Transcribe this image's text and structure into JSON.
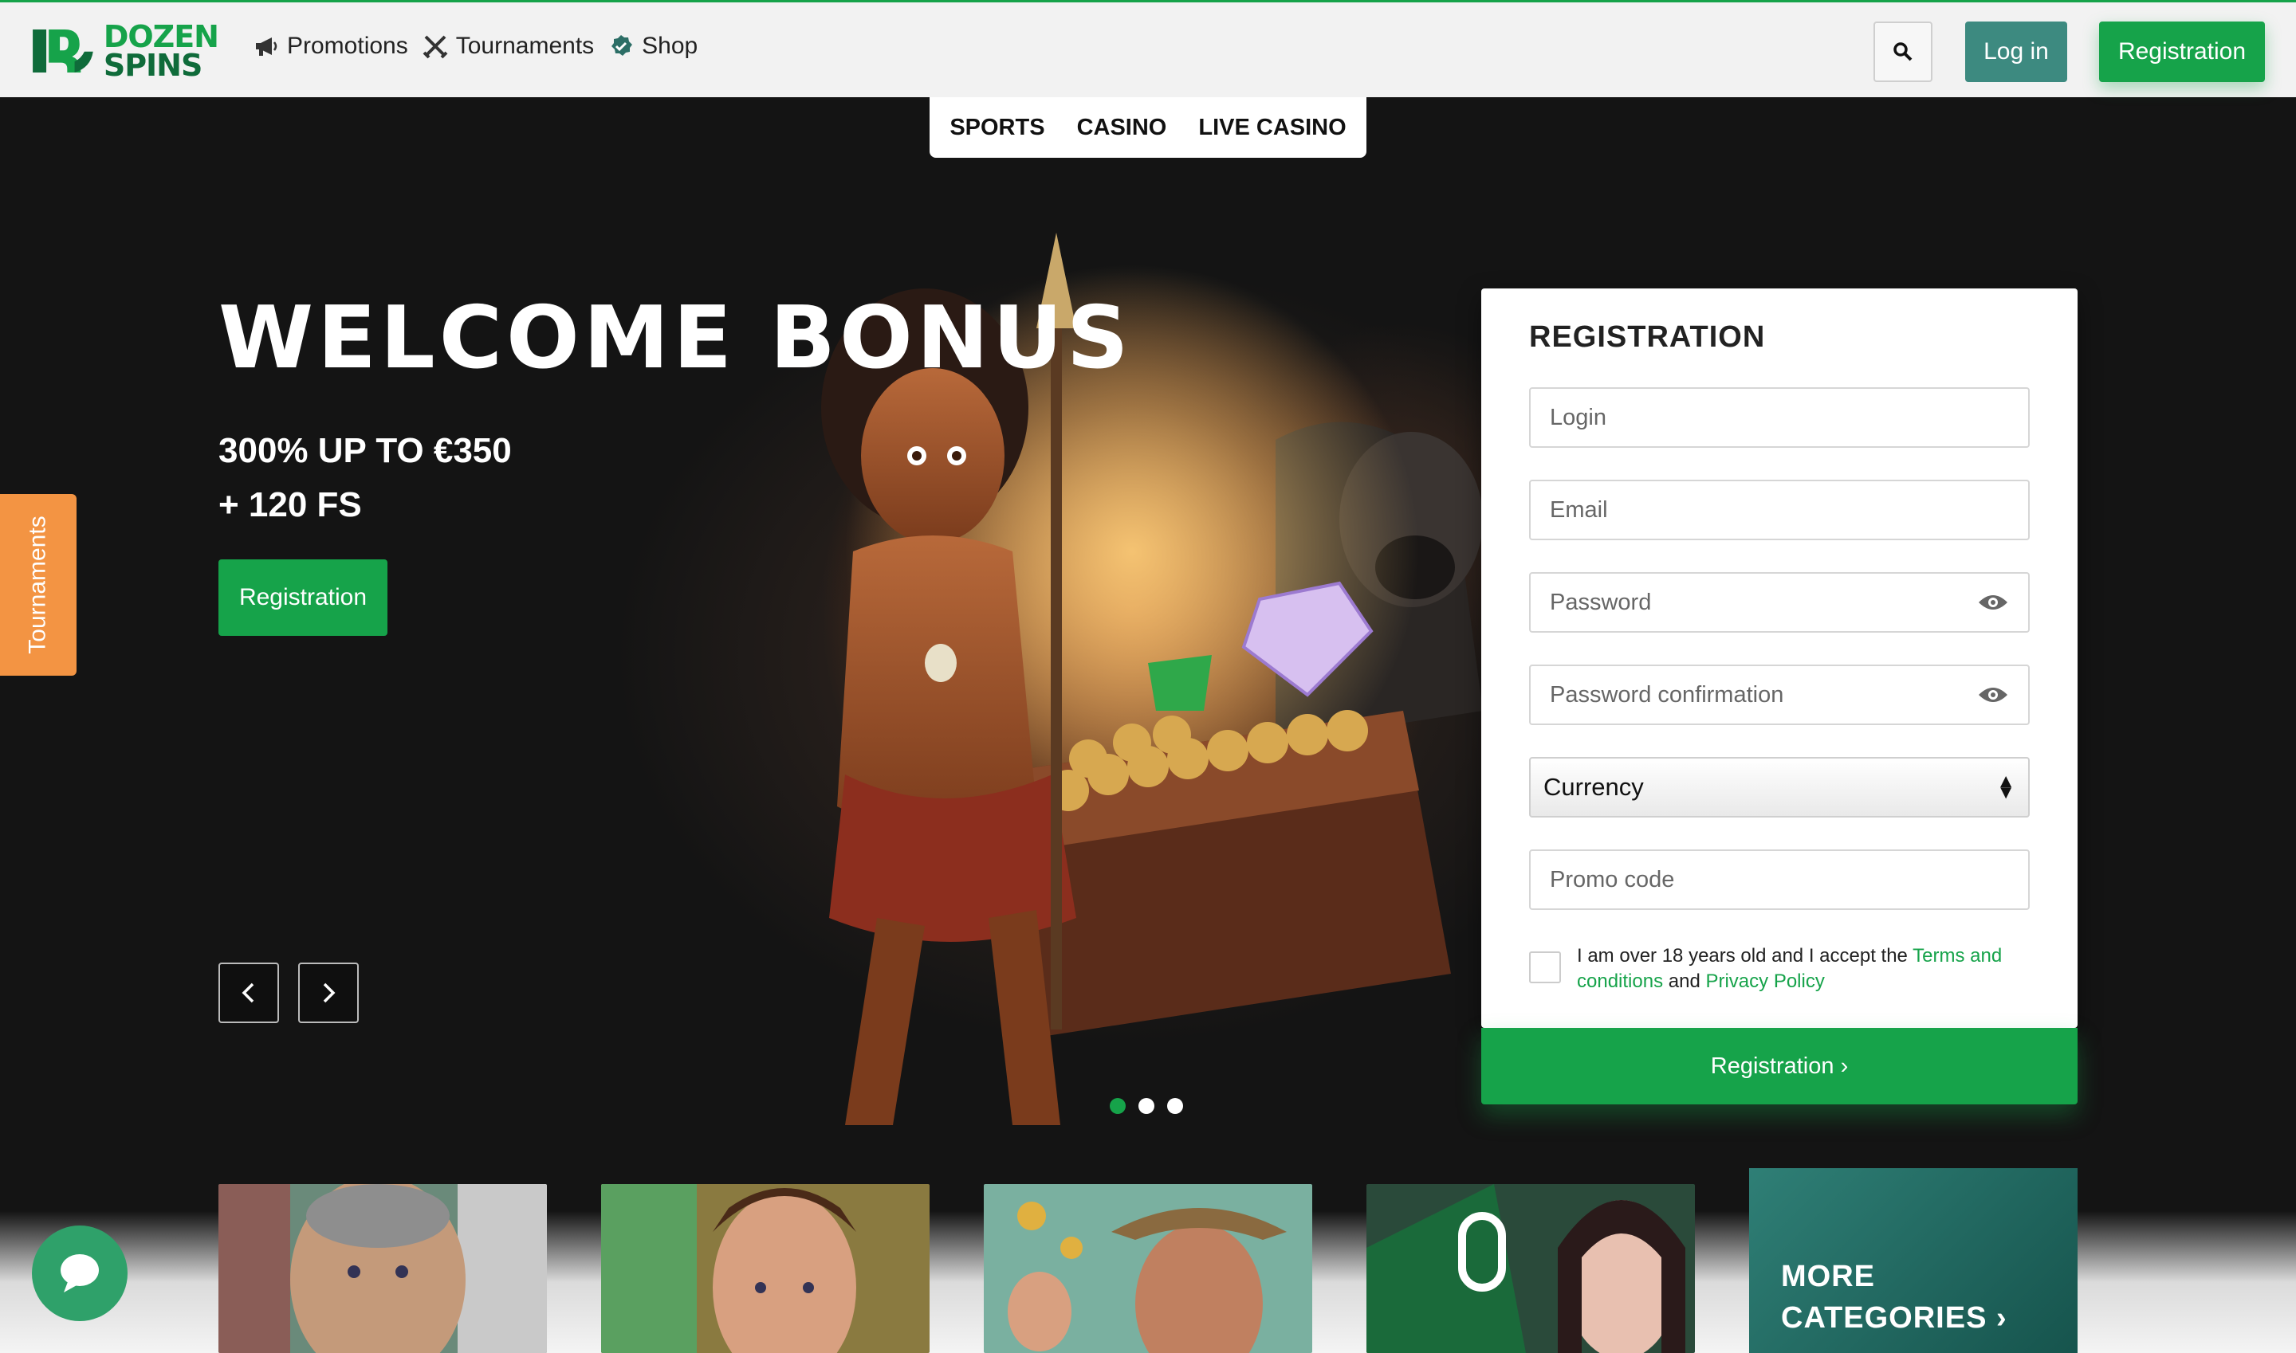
{
  "brand": {
    "logo_line1": "DOZEN",
    "logo_line2": "SPINS",
    "accent": "#16a34a",
    "orange": "#f39443",
    "teal": "#3d8a80"
  },
  "topnav": [
    {
      "label": "Promotions",
      "icon": "megaphone-icon"
    },
    {
      "label": "Tournaments",
      "icon": "crossed-swords-icon"
    },
    {
      "label": "Shop",
      "icon": "shop-badge-icon"
    }
  ],
  "header": {
    "search_icon": "search-icon",
    "login_label": "Log in",
    "register_label": "Registration"
  },
  "subtabs": [
    "SPORTS",
    "CASINO",
    "LIVE CASINO"
  ],
  "hero": {
    "title": "WELCOME BONUS",
    "line1": "300% UP TO €350",
    "line2": "+ 120 FS",
    "cta": "Registration",
    "slides": 3,
    "active_slide": 1
  },
  "side_tab": "Tournaments",
  "registration": {
    "title": "REGISTRATION",
    "login_placeholder": "Login",
    "email_placeholder": "Email",
    "password_placeholder": "Password",
    "password_confirm_placeholder": "Password confirmation",
    "currency_label": "Currency",
    "promo_placeholder": "Promo code",
    "consent_prefix": "I am over 18 years old and I accept the ",
    "terms_link": "Terms and conditions",
    "consent_and": " and ",
    "privacy_link": "Privacy Policy",
    "submit_label": "Registration ›"
  },
  "games": {
    "more_line1": "MORE",
    "more_line2": "CATEGORIES ›"
  }
}
